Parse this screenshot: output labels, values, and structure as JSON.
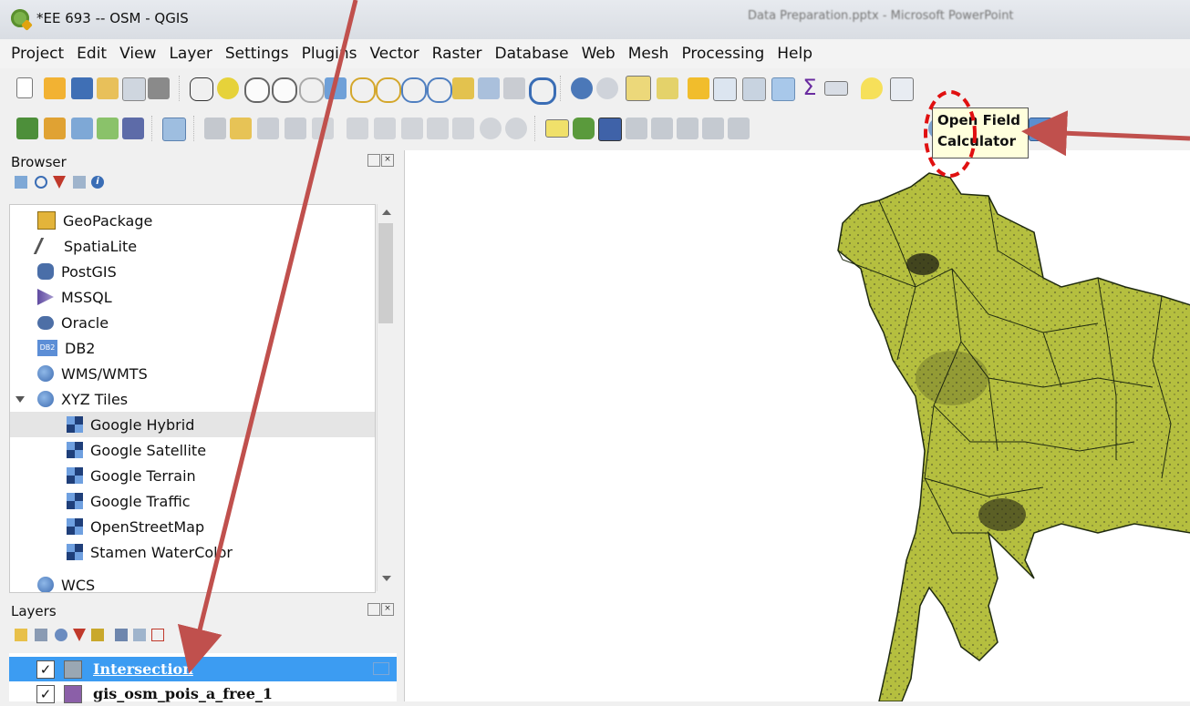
{
  "window": {
    "title": "*EE 693 -- OSM - QGIS",
    "background_title": "Data Preparation.pptx - Microsoft PowerPoint"
  },
  "menu": [
    {
      "label": "Project"
    },
    {
      "label": "Edit"
    },
    {
      "label": "View"
    },
    {
      "label": "Layer"
    },
    {
      "label": "Settings"
    },
    {
      "label": "Plugins"
    },
    {
      "label": "Vector"
    },
    {
      "label": "Raster"
    },
    {
      "label": "Database"
    },
    {
      "label": "Web"
    },
    {
      "label": "Mesh"
    },
    {
      "label": "Processing"
    },
    {
      "label": "Help"
    }
  ],
  "browser": {
    "title": "Browser",
    "items": [
      {
        "label": "GeoPackage",
        "icon": "geopackage-icon"
      },
      {
        "label": "SpatiaLite",
        "icon": "spatialite-feather-icon"
      },
      {
        "label": "PostGIS",
        "icon": "postgis-elephant-icon"
      },
      {
        "label": "MSSQL",
        "icon": "mssql-icon"
      },
      {
        "label": "Oracle",
        "icon": "oracle-icon"
      },
      {
        "label": "DB2",
        "icon": "db2-icon"
      },
      {
        "label": "WMS/WMTS",
        "icon": "globe-icon"
      },
      {
        "label": "XYZ Tiles",
        "icon": "globe-icon"
      },
      {
        "label": "Google Hybrid",
        "icon": "tile-icon"
      },
      {
        "label": "Google Satellite",
        "icon": "tile-icon"
      },
      {
        "label": "Google Terrain",
        "icon": "tile-icon"
      },
      {
        "label": "Google Traffic",
        "icon": "tile-icon"
      },
      {
        "label": "OpenStreetMap",
        "icon": "tile-icon"
      },
      {
        "label": "Stamen WaterColor",
        "icon": "tile-icon"
      },
      {
        "label": "WCS",
        "icon": "globe-icon"
      }
    ],
    "db2_badge": "DB2"
  },
  "layers": {
    "title": "Layers",
    "rows": [
      {
        "name": "Intersection",
        "checked": "✓",
        "color": "#9aa7b3"
      },
      {
        "name": "gis_osm_pois_a_free_1",
        "checked": "✓",
        "color": "#8b5fa8"
      }
    ]
  },
  "tooltip": {
    "line1": "Open Field",
    "line2": "Calculator"
  },
  "colors": {
    "map_fill": "#b5bf3f",
    "selection": "#3c9cf2",
    "annotation": "#c0504d"
  }
}
